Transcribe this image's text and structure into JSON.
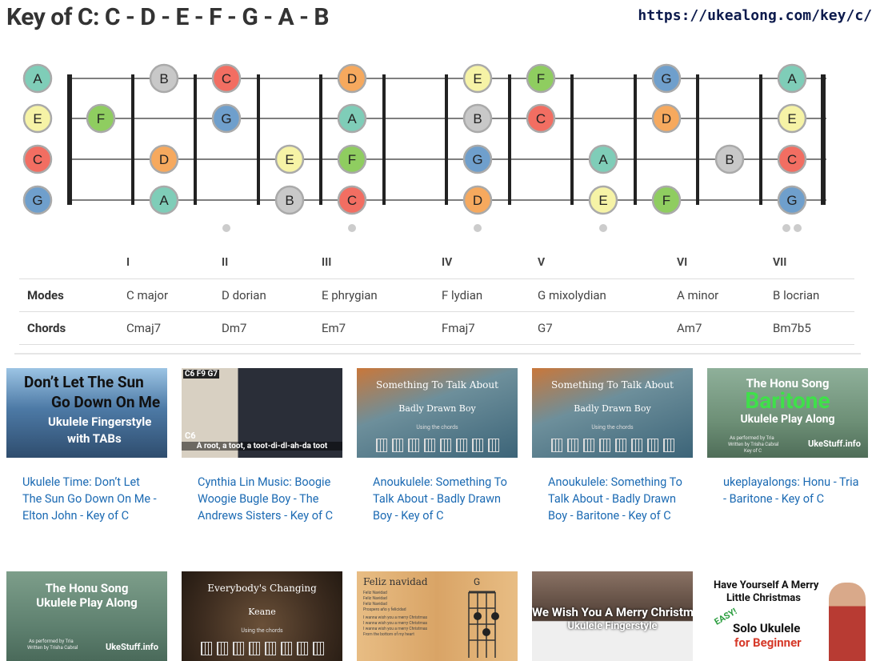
{
  "header": {
    "title": "Key of C: C - D - E - F - G - A - B",
    "url": "https://ukealong.com/key/c/"
  },
  "fretboard": {
    "strings": [
      "A",
      "E",
      "C",
      "G"
    ],
    "note_colors": {
      "A": "#7fcdb8",
      "B": "#c8c8c8",
      "C": "#f26e62",
      "D": "#f6a95e",
      "E": "#f6f3a6",
      "F": "#8fcd60",
      "G": "#6f9fcc"
    },
    "notes": [
      {
        "string": 0,
        "fret": 0,
        "note": "A"
      },
      {
        "string": 1,
        "fret": 0,
        "note": "E"
      },
      {
        "string": 2,
        "fret": 0,
        "note": "C"
      },
      {
        "string": 3,
        "fret": 0,
        "note": "G"
      },
      {
        "string": 1,
        "fret": 1,
        "note": "F"
      },
      {
        "string": 0,
        "fret": 2,
        "note": "B"
      },
      {
        "string": 2,
        "fret": 2,
        "note": "D"
      },
      {
        "string": 3,
        "fret": 2,
        "note": "A"
      },
      {
        "string": 0,
        "fret": 3,
        "note": "C"
      },
      {
        "string": 1,
        "fret": 3,
        "note": "G"
      },
      {
        "string": 2,
        "fret": 4,
        "note": "E"
      },
      {
        "string": 3,
        "fret": 4,
        "note": "B"
      },
      {
        "string": 0,
        "fret": 5,
        "note": "D"
      },
      {
        "string": 1,
        "fret": 5,
        "note": "A"
      },
      {
        "string": 2,
        "fret": 5,
        "note": "F"
      },
      {
        "string": 3,
        "fret": 5,
        "note": "C"
      },
      {
        "string": 0,
        "fret": 7,
        "note": "E"
      },
      {
        "string": 1,
        "fret": 7,
        "note": "B"
      },
      {
        "string": 2,
        "fret": 7,
        "note": "G"
      },
      {
        "string": 3,
        "fret": 7,
        "note": "D"
      },
      {
        "string": 0,
        "fret": 8,
        "note": "F"
      },
      {
        "string": 1,
        "fret": 8,
        "note": "C"
      },
      {
        "string": 2,
        "fret": 9,
        "note": "A"
      },
      {
        "string": 3,
        "fret": 9,
        "note": "E"
      },
      {
        "string": 0,
        "fret": 10,
        "note": "G"
      },
      {
        "string": 1,
        "fret": 10,
        "note": "D"
      },
      {
        "string": 3,
        "fret": 10,
        "note": "F"
      },
      {
        "string": 2,
        "fret": 11,
        "note": "B"
      },
      {
        "string": 0,
        "fret": 12,
        "note": "A"
      },
      {
        "string": 1,
        "fret": 12,
        "note": "E"
      },
      {
        "string": 2,
        "fret": 12,
        "note": "C"
      },
      {
        "string": 3,
        "fret": 12,
        "note": "G"
      }
    ],
    "marker_frets": [
      3,
      5,
      7,
      9
    ],
    "double_marker_fret": 12
  },
  "modes_table": {
    "degrees": [
      "I",
      "II",
      "III",
      "IV",
      "V",
      "VI",
      "VII"
    ],
    "modes_label": "Modes",
    "modes": [
      "C major",
      "D dorian",
      "E phrygian",
      "F lydian",
      "G mixolydian",
      "A minor",
      "B locrian"
    ],
    "chords_label": "Chords",
    "chords": [
      "Cmaj7",
      "Dm7",
      "Em7",
      "Fmaj7",
      "G7",
      "Am7",
      "Bm7b5"
    ]
  },
  "videos": [
    {
      "title": "Ukulele Time: Don’t Let The Sun Go Down On Me - Elton John - Key of C",
      "thumb_lines": [
        "Don’t Let The Sun",
        "Go Down On Me",
        "Ukulele Fingerstyle",
        "with TABs"
      ],
      "bg": "#5b7fa6"
    },
    {
      "title": "Cynthia Lin Music: Boogie Woogie Bugle Boy - The Andrews Sisters - Key of C",
      "thumb_lines": [
        "C6  F9  G7",
        "C6",
        "A root, a toot, a toot-di-dl-ah-da toot"
      ],
      "bg": "#3a3e47"
    },
    {
      "title": "Anoukulele: Something To Talk About - Badly Drawn Boy - Key of C",
      "thumb_lines": [
        "Something To Talk About",
        "Badly Drawn Boy",
        "Using the chords"
      ],
      "bg": "#5a7c88"
    },
    {
      "title": "Anoukulele: Something To Talk About - Badly Drawn Boy - Baritone - Key of C",
      "thumb_lines": [
        "Something To Talk About",
        "Badly Drawn Boy",
        "Using the chords"
      ],
      "bg": "#5a7c88"
    },
    {
      "title": "ukeplayalongs: Honu - Tria - Baritone - Key of C",
      "thumb_lines": [
        "The Honu Song",
        "Baritone",
        "Ukulele Play Along",
        "As performed by Tria",
        "Written by Trisha Cabral",
        "Key of C",
        "UkeStuff.info"
      ],
      "bg": "#7d9b7c"
    },
    {
      "title": "",
      "thumb_lines": [
        "The Honu Song",
        "Ukulele Play Along",
        "As performed by Tria",
        "Written by Trisha Cabral",
        "UkeStuff.info"
      ],
      "bg": "#6c8d76"
    },
    {
      "title": "",
      "thumb_lines": [
        "Everybody's Changing",
        "Keane",
        "Using the chords"
      ],
      "bg": "#4c3a2c"
    },
    {
      "title": "",
      "thumb_lines": [
        "Feliz navidad",
        "G",
        "Feliz Navidad",
        "Feliz Navidad",
        "Feliz Navidad",
        "Prospero año y felicidad",
        "I wanna wish you a merry Christmas",
        "I wanna wish you a merry Christmas",
        "I wanna wish you a merry Christmas",
        "From the bottom of my heart"
      ],
      "bg": "#e6b77c"
    },
    {
      "title": "",
      "thumb_lines": [
        "We Wish You A Merry Christmas",
        "Ukulele Fingerstyle"
      ],
      "bg": "#5b4a40"
    },
    {
      "title": "",
      "thumb_lines": [
        "Have Yourself A Merry",
        "Little Christmas",
        "EASY!",
        "Solo Ukulele",
        "for Beginner"
      ],
      "bg": "#ffffff"
    }
  ]
}
